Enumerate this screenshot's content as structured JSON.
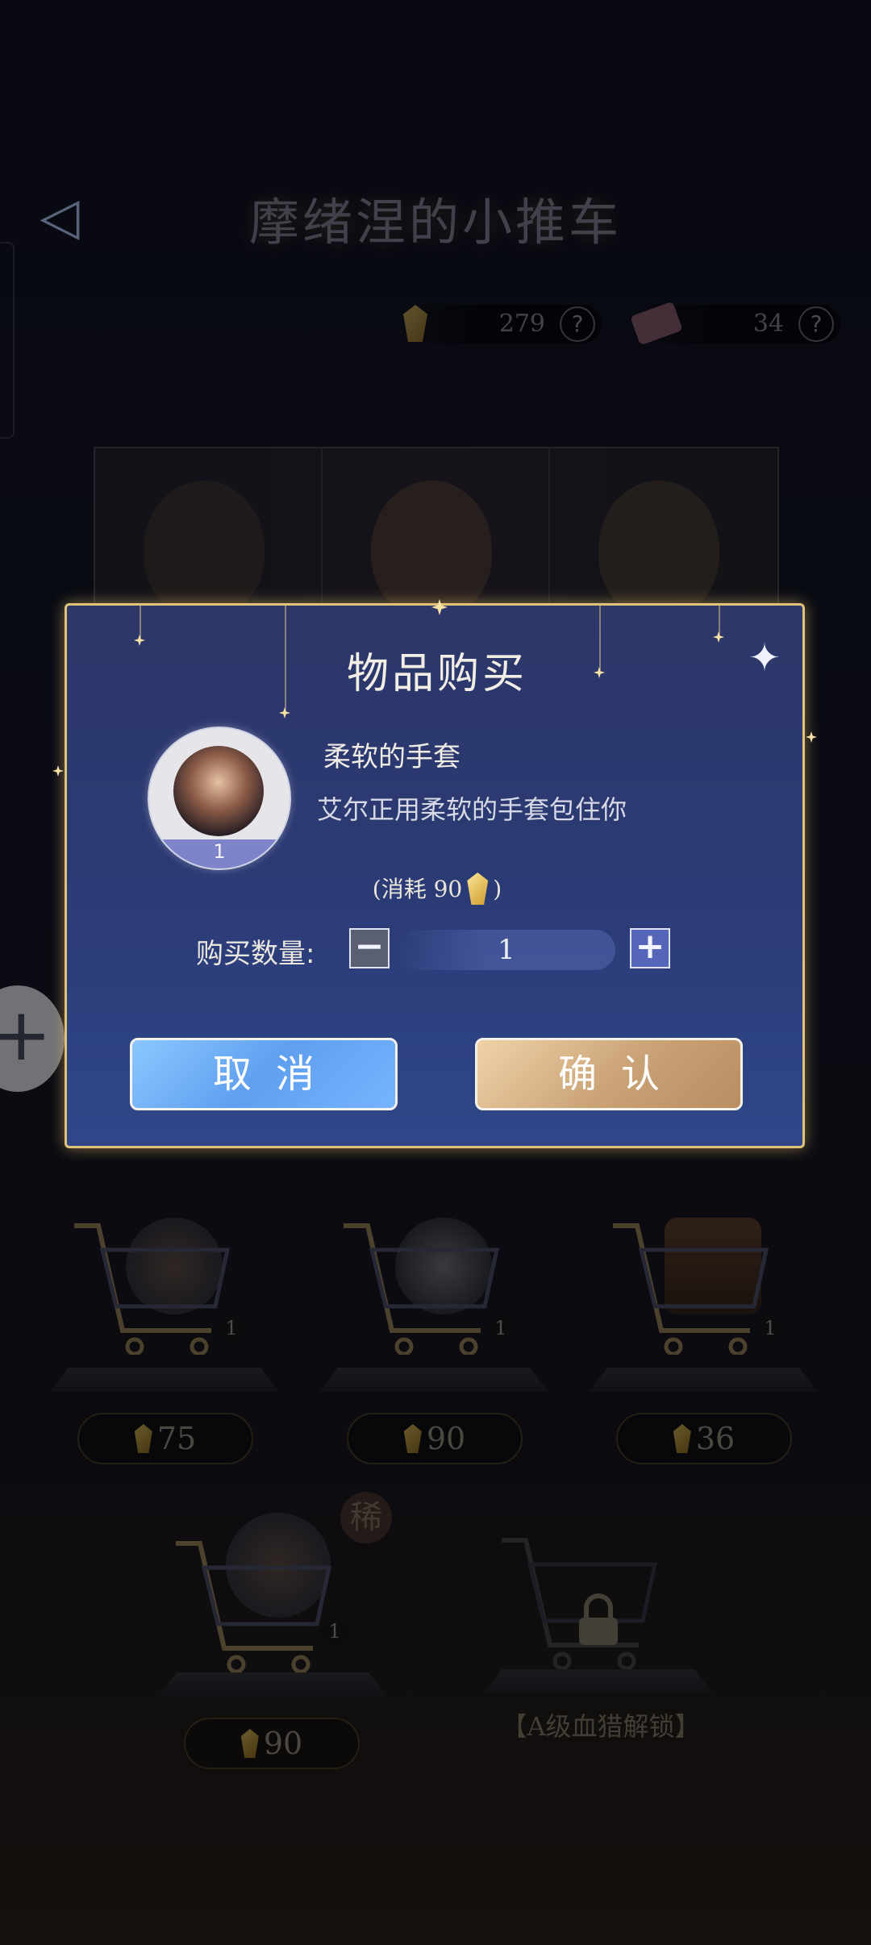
{
  "header": {
    "title": "摩绪涅的小推车",
    "back_icon": "back-arrow-icon"
  },
  "currencies": [
    {
      "name": "gem",
      "value": "279",
      "help": "?"
    },
    {
      "name": "ticket",
      "value": "34",
      "help": "?"
    }
  ],
  "background_items": [
    {
      "count": "1",
      "price": "75"
    },
    {
      "count": "1",
      "price": "90"
    },
    {
      "count": "1",
      "price": "36"
    },
    {
      "count": "1",
      "price": "90",
      "badge": "稀"
    }
  ],
  "locked_slot": {
    "text": "【A级血猎解锁】"
  },
  "dialog": {
    "title": "物品购买",
    "item_name": "柔软的手套",
    "item_desc": "艾尔正用柔软的手套包住你",
    "item_count": "1",
    "cost_prefix": "(消耗 90",
    "cost_suffix": ")",
    "qty_label": "购买数量:",
    "qty_value": "1",
    "cancel_label": "取消",
    "confirm_label": "确认"
  }
}
